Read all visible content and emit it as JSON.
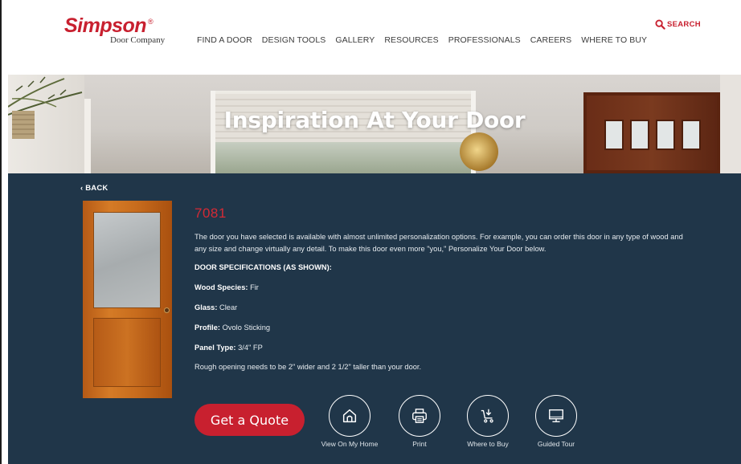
{
  "header": {
    "logo": {
      "brand": "Simpson",
      "reg": "®",
      "subtitle": "Door Company"
    },
    "nav": [
      "FIND A DOOR",
      "DESIGN TOOLS",
      "GALLERY",
      "RESOURCES",
      "PROFESSIONALS",
      "CAREERS",
      "WHERE TO BUY"
    ],
    "search_label": "SEARCH"
  },
  "hero": {
    "title": "Inspiration At Your Door"
  },
  "product": {
    "back_label": "‹ BACK",
    "model": "7081",
    "description": "The door you have selected is available with almost unlimited personalization options. For example, you can order this door in any type of wood and any size and change virtually any detail. To make this door even more \"you,\" Personalize Your Door below.",
    "spec_heading": "DOOR SPECIFICATIONS (AS SHOWN):",
    "specs": [
      {
        "label": "Wood Species:",
        "value": "Fir"
      },
      {
        "label": "Glass:",
        "value": "Clear"
      },
      {
        "label": "Profile:",
        "value": "Ovolo Sticking"
      },
      {
        "label": "Panel Type:",
        "value": "3/4\" FP"
      }
    ],
    "rough_opening": "Rough opening needs to be 2\" wider and 2 1/2\" taller than your door."
  },
  "actions": {
    "quote_label": "Get a Quote",
    "items": [
      {
        "label": "View On My Home",
        "icon": "house-icon"
      },
      {
        "label": "Print",
        "icon": "printer-icon"
      },
      {
        "label": "Where to Buy",
        "icon": "cart-icon"
      },
      {
        "label": "Guided Tour",
        "icon": "monitor-icon"
      }
    ]
  },
  "colors": {
    "brand_red": "#c8202f",
    "panel_navy": "#203649"
  }
}
